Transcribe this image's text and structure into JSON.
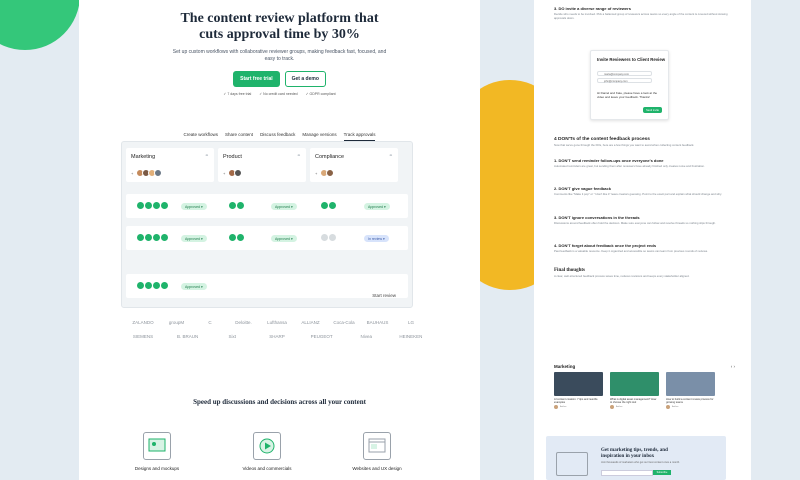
{
  "hero": {
    "title_line1": "The content review platform that",
    "title_line2": "cuts approval time by 30%",
    "subtitle": "Set up custom workflows with collaborative reviewer groups, making feedback fast, focused, and easy to track.",
    "cta_primary": "Start free trial",
    "cta_secondary": "Get a demo",
    "checks": [
      "✓ 7 days free trial",
      "✓ No credit card needed",
      "✓ GDPR compliant"
    ]
  },
  "tabs": [
    {
      "label": "Create workflows",
      "active": false
    },
    {
      "label": "Share content",
      "active": false
    },
    {
      "label": "Discuss feedback",
      "active": false
    },
    {
      "label": "Manage versions",
      "active": false
    },
    {
      "label": "Track approvals",
      "active": true
    }
  ],
  "board": {
    "columns": [
      {
        "name": "Marketing"
      },
      {
        "name": "Product"
      },
      {
        "name": "Compliance"
      }
    ],
    "rows": [
      {
        "cells": [
          {
            "status": "Approved"
          },
          {
            "status": "Approved"
          },
          {
            "status": "Approved"
          }
        ]
      },
      {
        "cells": [
          {
            "status": "Approved"
          },
          {
            "status": "Approved"
          },
          {
            "status": "In review"
          }
        ]
      },
      {
        "cells": [
          {
            "status": "Approved"
          },
          {
            "status": ""
          },
          {
            "status": ""
          }
        ]
      }
    ],
    "start_review": "Start review"
  },
  "logos": [
    "ZALANDO",
    "groupM",
    "C",
    "Deloitte.",
    "Lufthansa",
    "ALLIANZ",
    "Coca-Cola",
    "BAUHAUS",
    "LG",
    "SIEMENS",
    "B. BRAUN",
    "Sixt",
    "SHARP",
    "PEUGEOT",
    "Nivea",
    "HEINEKEN"
  ],
  "speed_heading": "Speed up discussions and decisions across all your content",
  "features": [
    {
      "label": "Designs and mockups",
      "icon": "design-icon"
    },
    {
      "label": "Videos and commercials",
      "icon": "video-icon"
    },
    {
      "label": "Websites and UX design",
      "icon": "website-icon"
    }
  ],
  "article": {
    "intro_heading": "3. DO invite a diverse range of reviewers",
    "intro_text": "Decide who needs to be involved. Pick a balanced group of reviewers across teams so every angle of the content is covered without slowing approvals down.",
    "modal": {
      "title": "Invite Reviewers to Client Review",
      "emails": [
        "maria@company.com",
        "john@company.com"
      ],
      "note": "Hi Daniel and Kate, please have a look at the video and leave your feedback. Thanks!",
      "button": "Send invite"
    },
    "section_heading": "4 DON'Ts of the content feedback process",
    "section_text": "Now that we've gone through the DOs, here are a few things you want to avoid when collecting content feedback.",
    "items": [
      {
        "heading": "1. DON'T send reminder follow-ups once everyone's done",
        "text": "Automated reminders are great, but sending them after reviewers have already finished only creates noise and frustration."
      },
      {
        "heading": "2. DON'T give vague feedback",
        "text": "Comments like \"Make it pop\" or \"I don't like it\" leave creators guessing. Point to the exact part and explain what should change and why."
      },
      {
        "heading": "3. DON'T ignore conversations in the threads",
        "text": "Discussions around feedback often hold the decision. Make sure everyone can follow and resolve threads so nothing slips through."
      },
      {
        "heading": "4. DON'T forget about feedback once the project ends",
        "text": "Past feedback is a valuable resource. Keep it organized and accessible so teams can learn from previous rounds of reviews."
      }
    ],
    "final_heading": "Final thoughts",
    "final_text": "A clear, well-structured feedback process saves time, reduces revisions and keeps every stakeholder aligned."
  },
  "marketing": {
    "title": "Marketing",
    "arrows": "‹ ›",
    "cards": [
      {
        "text": "AI content creation: 7 tips and real-life examples",
        "author": "Author",
        "color": "#3a4b5c"
      },
      {
        "text": "What is digital asset management? How to choose the right tool",
        "author": "Author",
        "color": "#2f8f6a"
      },
      {
        "text": "How to build a content review process for growing teams",
        "author": "Author",
        "color": "#7a8fa8"
      }
    ]
  },
  "newsletter": {
    "title": "Get marketing tips, trends, and inspiration in your inbox",
    "subtitle": "Join thousands of marketers who get our best content once a month.",
    "button": "Subscribe"
  },
  "colors": {
    "accent": "#1fb36b",
    "review_blue": "#3d5ca8",
    "dark": "#1e2a3a"
  }
}
